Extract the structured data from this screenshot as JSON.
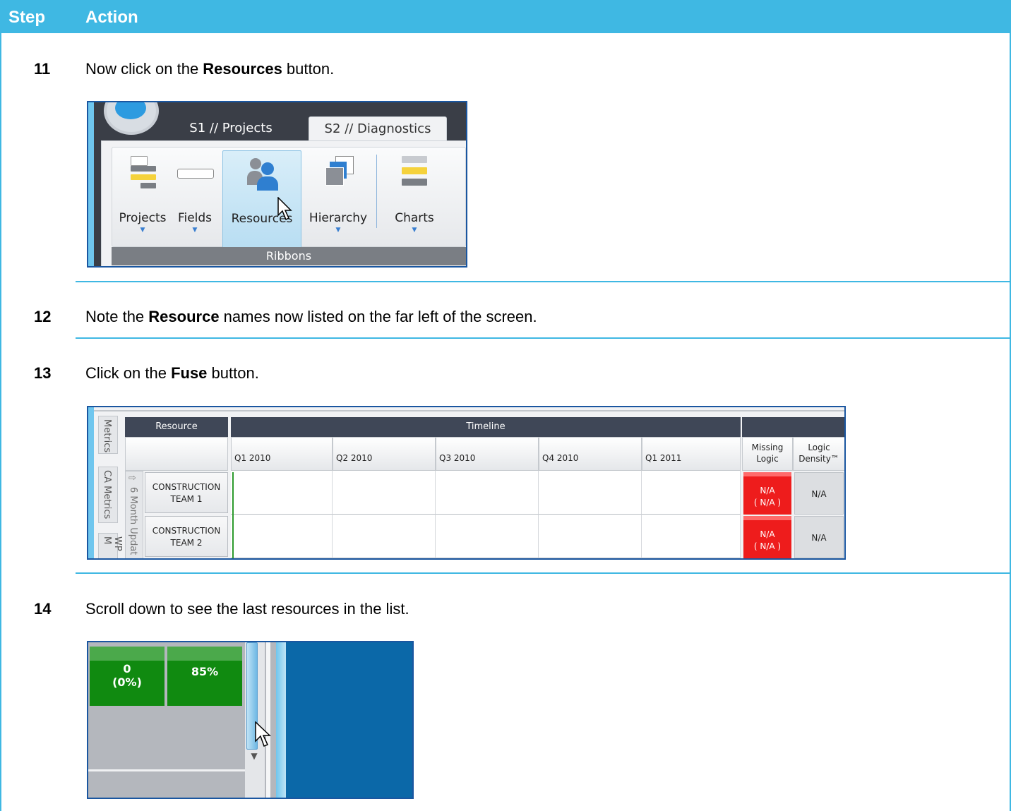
{
  "header": {
    "step": "Step",
    "action": "Action"
  },
  "steps": [
    {
      "num": "11",
      "pre": "Now click on the ",
      "bold": "Resources",
      "post": " button."
    },
    {
      "num": "12",
      "pre": "Note the ",
      "bold": "Resource",
      "post": " names now listed on the far left of the screen."
    },
    {
      "num": "13",
      "pre": "Click on the ",
      "bold": "Fuse",
      "post": " button."
    },
    {
      "num": "14",
      "pre": "Scroll down to see the last resources in the list.",
      "bold": "",
      "post": ""
    }
  ],
  "ribbon": {
    "tabs": [
      "S1 // Projects",
      "S2 // Diagnostics"
    ],
    "buttons": [
      "Projects",
      "Fields",
      "Resources",
      "Hierarchy",
      "Charts"
    ],
    "group_label": "Ribbons"
  },
  "grid": {
    "side_tabs": [
      "Metrics",
      "CA Metrics",
      "WP M"
    ],
    "row_tab": "6 Month Updat",
    "resource_header": "Resource",
    "timeline_header": "Timeline",
    "quarters": [
      "Q1 2010",
      "Q2 2010",
      "Q3 2010",
      "Q4 2010",
      "Q1 2011"
    ],
    "metric_cols": [
      "Missing Logic",
      "Logic Density™"
    ],
    "rows": [
      {
        "name": "CONSTRUCTION TEAM 1",
        "missing": "N/A",
        "missing_sub": "( N/A )",
        "density": "N/A"
      },
      {
        "name": "CONSTRUCTION TEAM 2",
        "missing": "N/A",
        "missing_sub": "( N/A )",
        "density": "N/A"
      }
    ]
  },
  "scroll": {
    "tile1_value": "0",
    "tile1_sub": "(0%)",
    "tile2_value": "85%"
  },
  "colors": {
    "accent": "#3fb8e3",
    "red": "#ee1c1c",
    "green": "#108a10",
    "dark_header": "#3f4757"
  }
}
